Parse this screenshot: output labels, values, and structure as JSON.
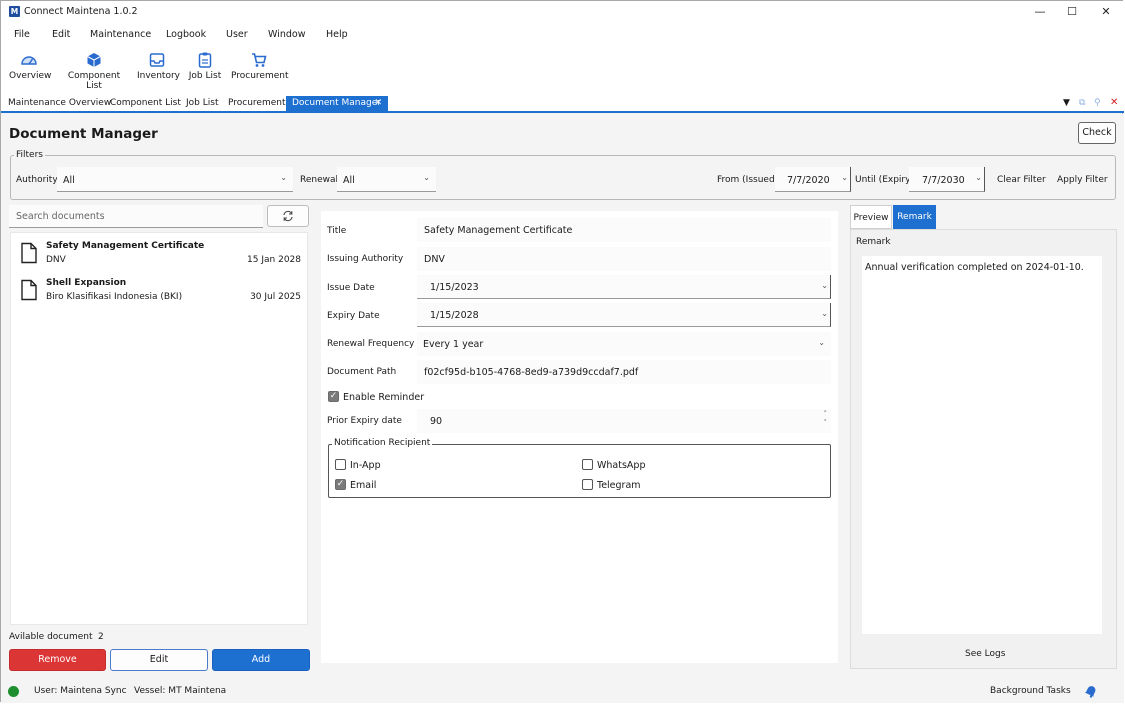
{
  "app": {
    "title": "Connect Maintena 1.0.2",
    "icon_letter": "M"
  },
  "window_controls": [
    "—",
    "☐",
    "✕"
  ],
  "menu": [
    "File",
    "Edit",
    "Maintenance",
    "Logbook",
    "User",
    "Window",
    "Help"
  ],
  "toolbar": [
    "Overview",
    "Component List",
    "Inventory",
    "Job List",
    "Procurement"
  ],
  "doc_tabs": [
    "Maintenance Overview",
    "Component List",
    "Job List",
    "Procurement"
  ],
  "active_tab": "Document Manager",
  "page_title": "Document Manager",
  "check_label": "Check",
  "filters": {
    "legend": "Filters",
    "authority_label": "Authority",
    "authority_value": "All",
    "renewal_label": "Renewal",
    "renewal_value": "All",
    "from_label": "From (Issued)",
    "from_value": "7/7/2020",
    "until_label": "Until (Expiry)",
    "until_value": "7/7/2030",
    "clear": "Clear Filter",
    "apply": "Apply Filter"
  },
  "search": {
    "placeholder": "Search documents"
  },
  "documents": [
    {
      "title": "Safety Management Certificate",
      "authority": "DNV",
      "date": "15 Jan 2028"
    },
    {
      "title": "Shell Expansion",
      "authority": "Biro Klasifikasi Indonesia (BKI)",
      "date": "30 Jul 2025"
    }
  ],
  "available": {
    "label": "Avilable document",
    "count": "2"
  },
  "buttons": {
    "remove": "Remove",
    "edit": "Edit",
    "add": "Add"
  },
  "detail": {
    "title_label": "Title",
    "title_value": "Safety Management Certificate",
    "authority_label": "Issuing Authority",
    "authority_value": "DNV",
    "issue_label": "Issue Date",
    "issue_value": "1/15/2023",
    "expiry_label": "Expiry Date",
    "expiry_value": "1/15/2028",
    "renewal_label": "Renewal Frequency",
    "renewal_value": "Every 1 year",
    "path_label": "Document Path",
    "path_value": "f02cf95d-b105-4768-8ed9-a739d9ccdaf7.pdf",
    "reminder_label": "Enable Reminder",
    "reminder_checked": true,
    "prior_label": "Prior Expiry date",
    "prior_value": "90",
    "notif_legend": "Notification Recipient",
    "recipients": [
      {
        "label": "In-App",
        "checked": false
      },
      {
        "label": "WhatsApp",
        "checked": false
      },
      {
        "label": "Email",
        "checked": true
      },
      {
        "label": "Telegram",
        "checked": false
      }
    ]
  },
  "right": {
    "tab_preview": "Preview",
    "tab_remark": "Remark",
    "remark_label": "Remark",
    "remark_text": "Annual verification completed on 2024-01-10.",
    "see_logs": "See Logs"
  },
  "status": {
    "user": "User: Maintena Sync",
    "vessel": "Vessel: MT Maintena",
    "tasks": "Background Tasks"
  },
  "colors": {
    "accent": "#1d6fd0",
    "danger": "#dc3535",
    "online": "#1e8e2e"
  }
}
